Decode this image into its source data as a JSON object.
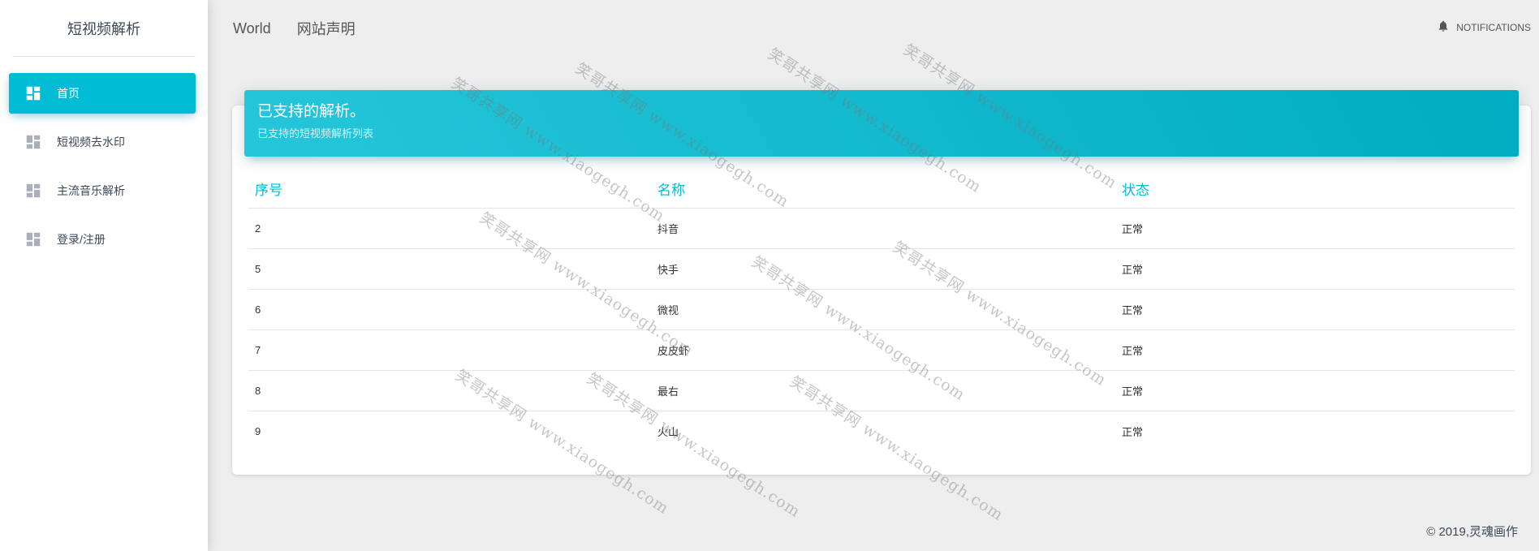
{
  "sidebar": {
    "brand": "短视频解析",
    "items": [
      {
        "label": "首页",
        "icon": "dashboard-icon",
        "active": true
      },
      {
        "label": "短视频去水印",
        "icon": "dashboard-icon",
        "active": false
      },
      {
        "label": "主流音乐解析",
        "icon": "dashboard-icon",
        "active": false
      },
      {
        "label": "登录/注册",
        "icon": "dashboard-icon",
        "active": false
      }
    ]
  },
  "topbar": {
    "links": [
      "World",
      "网站声明"
    ],
    "notifications_label": "NOTIFICATIONS",
    "notifications_icon": "bell-icon"
  },
  "card": {
    "title": "已支持的解析。",
    "subtitle": "已支持的短视频解析列表"
  },
  "table": {
    "headers": [
      "序号",
      "名称",
      "状态"
    ],
    "rows": [
      [
        "2",
        "抖音",
        "正常"
      ],
      [
        "5",
        "快手",
        "正常"
      ],
      [
        "6",
        "微视",
        "正常"
      ],
      [
        "7",
        "皮皮虾",
        "正常"
      ],
      [
        "8",
        "最右",
        "正常"
      ],
      [
        "9",
        "火山",
        "正常"
      ]
    ]
  },
  "footer": "© 2019,灵魂画作",
  "watermark": "笑哥共享网 www.xiaogegh.com",
  "colors": {
    "accent": "#00bcd4",
    "header_gradient_start": "#26c6da",
    "header_gradient_end": "#00acc1",
    "background": "#eeeeee"
  }
}
